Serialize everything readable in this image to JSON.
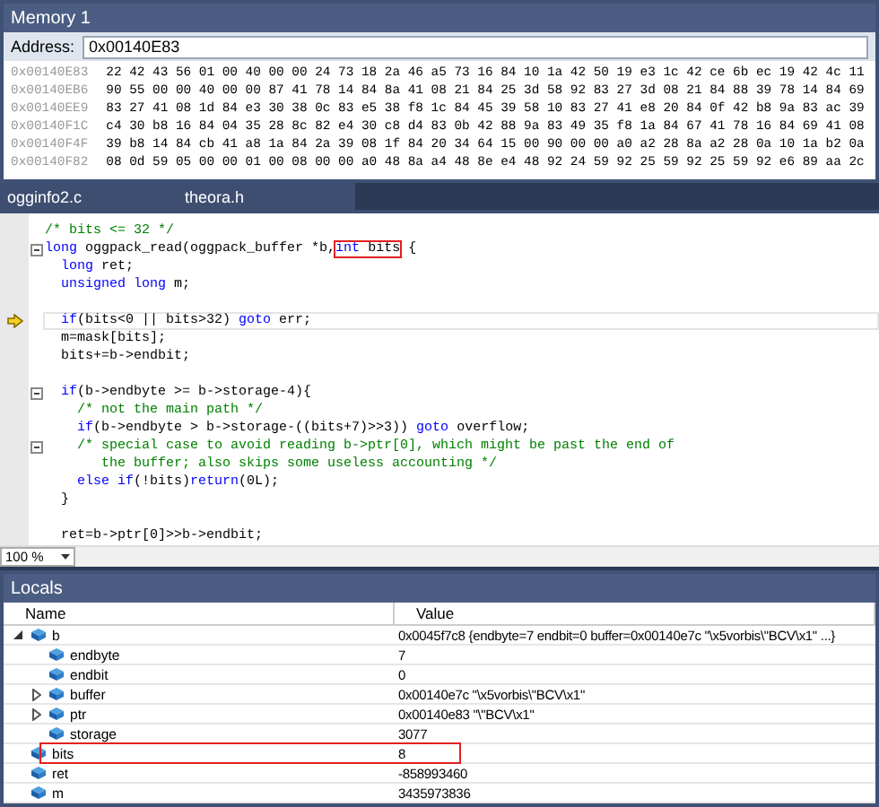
{
  "memory": {
    "title": "Memory 1",
    "address_label": "Address:",
    "address": "0x00140E83",
    "rows": [
      {
        "address": "0x00140E83",
        "bytes": "22 42 43 56 01 00 40 00 00 24 73 18 2a 46 a5 73 16 84 10 1a 42 50 19 e3 1c 42 ce 6b ec 19 42 4c 11"
      },
      {
        "address": "0x00140EB6",
        "bytes": "90 55 00 00 40 00 00 87 41 78 14 84 8a 41 08 21 84 25 3d 58 92 83 27 3d 08 21 84 88 39 78 14 84 69"
      },
      {
        "address": "0x00140EE9",
        "bytes": "83 27 41 08 1d 84 e3 30 38 0c 83 e5 38 f8 1c 84 45 39 58 10 83 27 41 e8 20 84 0f 42 b8 9a 83 ac 39"
      },
      {
        "address": "0x00140F1C",
        "bytes": "c4 30 b8 16 84 04 35 28 8c 82 e4 30 c8 d4 83 0b 42 88 9a 83 49 35 f8 1a 84 67 41 78 16 84 69 41 08"
      },
      {
        "address": "0x00140F4F",
        "bytes": "39 b8 14 84 cb 41 a8 1a 84 2a 39 08 1f 84 20 34 64 15 00 90 00 00 a0 a2 28 8a a2 28 0a 10 1a b2 0a"
      },
      {
        "address": "0x00140F82",
        "bytes": "08 0d 59 05 00 00 01 00 08 00 00 a0 48 8a a4 48 8e e4 48 92 24 59 92 25 59 92 25 59 92 e6 89 aa 2c"
      }
    ]
  },
  "tabs": [
    {
      "label": "ogginfo2.c",
      "selected": false
    },
    {
      "label": "theora.h",
      "selected": false
    }
  ],
  "editor": {
    "zoom": "100 %",
    "lines": [
      {
        "kind": "code",
        "fold": false,
        "current": false,
        "segments": [
          {
            "kind": "comment",
            "text": "/* bits <= 32 */"
          }
        ]
      },
      {
        "kind": "code",
        "fold": true,
        "current": false,
        "segments": [
          {
            "kind": "keyword",
            "text": "long"
          },
          {
            "kind": "plain",
            "text": " oggpack_read(oggpack_buffer *b,"
          },
          {
            "kind": "boxed",
            "parts": [
              {
                "kind": "keyword",
                "text": "int"
              },
              {
                "kind": "plain",
                "text": " bits"
              }
            ]
          },
          {
            "kind": "plain",
            "text": " {"
          }
        ]
      },
      {
        "kind": "code",
        "fold": false,
        "current": false,
        "segments": [
          {
            "kind": "keyword",
            "text": "  long"
          },
          {
            "kind": "plain",
            "text": " ret;"
          }
        ]
      },
      {
        "kind": "code",
        "fold": false,
        "current": false,
        "segments": [
          {
            "kind": "keyword",
            "text": "  unsigned long"
          },
          {
            "kind": "plain",
            "text": " m;"
          }
        ]
      },
      {
        "kind": "blank"
      },
      {
        "kind": "code",
        "fold": false,
        "current": true,
        "segments": [
          {
            "kind": "keyword",
            "text": "  if"
          },
          {
            "kind": "plain",
            "text": "(bits<0 || bits>32) "
          },
          {
            "kind": "keyword",
            "text": "goto"
          },
          {
            "kind": "plain",
            "text": " err;"
          }
        ]
      },
      {
        "kind": "code",
        "fold": false,
        "current": false,
        "segments": [
          {
            "kind": "plain",
            "text": "  m=mask[bits];"
          }
        ]
      },
      {
        "kind": "code",
        "fold": false,
        "current": false,
        "segments": [
          {
            "kind": "plain",
            "text": "  bits+=b->endbit;"
          }
        ]
      },
      {
        "kind": "blank"
      },
      {
        "kind": "code",
        "fold": true,
        "current": false,
        "segments": [
          {
            "kind": "keyword",
            "text": "  if"
          },
          {
            "kind": "plain",
            "text": "(b->endbyte >= b->storage-4){"
          }
        ]
      },
      {
        "kind": "code",
        "fold": false,
        "current": false,
        "segments": [
          {
            "kind": "comment",
            "text": "    /* not the main path */"
          }
        ]
      },
      {
        "kind": "code",
        "fold": false,
        "current": false,
        "segments": [
          {
            "kind": "keyword",
            "text": "    if"
          },
          {
            "kind": "plain",
            "text": "(b->endbyte > b->storage-((bits+7)>>3)) "
          },
          {
            "kind": "keyword",
            "text": "goto"
          },
          {
            "kind": "plain",
            "text": " overflow;"
          }
        ]
      },
      {
        "kind": "code",
        "fold": true,
        "current": false,
        "segments": [
          {
            "kind": "comment",
            "text": "    /* special case to avoid reading b->ptr[0], which might be past the end of"
          }
        ]
      },
      {
        "kind": "code",
        "fold": false,
        "current": false,
        "segments": [
          {
            "kind": "comment",
            "text": "       the buffer; also skips some useless accounting */"
          }
        ]
      },
      {
        "kind": "code",
        "fold": false,
        "current": false,
        "segments": [
          {
            "kind": "keyword",
            "text": "    else if"
          },
          {
            "kind": "plain",
            "text": "(!bits)"
          },
          {
            "kind": "keyword",
            "text": "return"
          },
          {
            "kind": "plain",
            "text": "(0L);"
          }
        ]
      },
      {
        "kind": "code",
        "fold": false,
        "current": false,
        "segments": [
          {
            "kind": "plain",
            "text": "  }"
          }
        ]
      },
      {
        "kind": "blank"
      },
      {
        "kind": "code",
        "fold": false,
        "current": false,
        "segments": [
          {
            "kind": "plain",
            "text": "  ret=b->ptr[0]>>b->endbit;"
          }
        ]
      }
    ]
  },
  "locals": {
    "title": "Locals",
    "columns": [
      "Name",
      "Value"
    ],
    "rows": [
      {
        "name": "b",
        "value": "0x0045f7c8 {endbyte=7 endbit=0 buffer=0x00140e7c \"\\x5vorbis\\\"BCV\\x1\" ...}",
        "expanded": true,
        "highlighted": false,
        "children": [
          {
            "name": "endbyte",
            "value": "7",
            "highlighted": false
          },
          {
            "name": "endbit",
            "value": "0",
            "highlighted": false
          },
          {
            "name": "buffer",
            "value": "0x00140e7c \"\\x5vorbis\\\"BCV\\x1\"",
            "expanded": false,
            "highlighted": false
          },
          {
            "name": "ptr",
            "value": "0x00140e83 \"\\\"BCV\\x1\"",
            "expanded": false,
            "highlighted": false
          },
          {
            "name": "storage",
            "value": "3077",
            "highlighted": false
          }
        ]
      },
      {
        "name": "bits",
        "value": "8",
        "highlighted": true
      },
      {
        "name": "ret",
        "value": "-858993460",
        "highlighted": false
      },
      {
        "name": "m",
        "value": "3435973836",
        "highlighted": false
      }
    ]
  }
}
